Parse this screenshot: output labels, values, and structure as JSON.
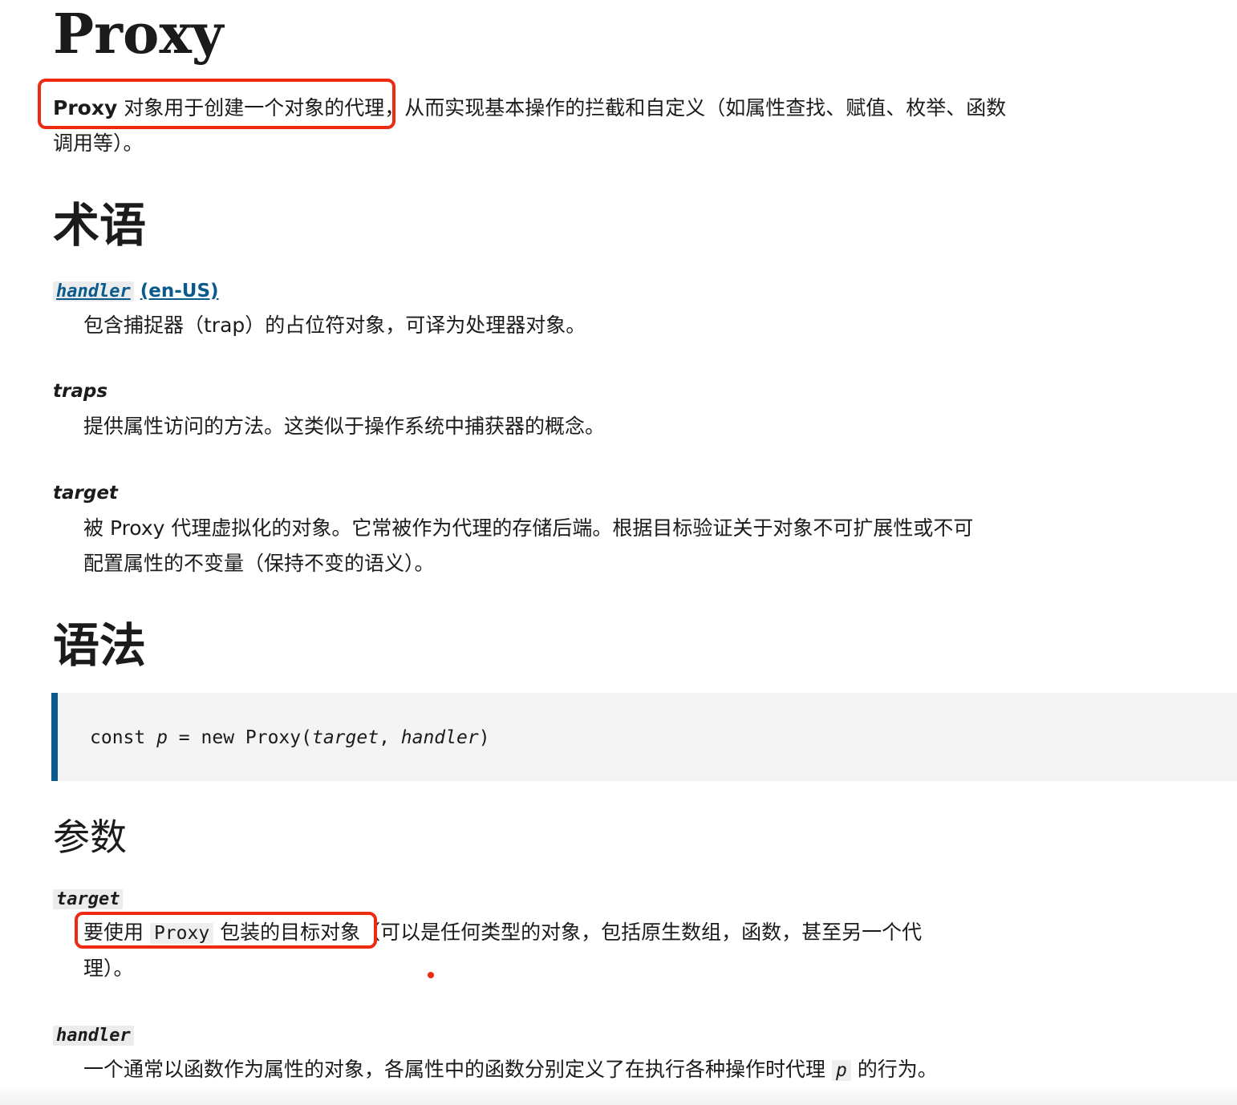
{
  "title": "Proxy",
  "intro": {
    "bold": "Proxy",
    "text": " 对象用于创建一个对象的代理，从而实现基本操作的拦截和自定义（如属性查找、赋值、枚举、函数调用等）。"
  },
  "terminology": {
    "heading": "术语",
    "items": [
      {
        "term": "handler",
        "link": "(en-US)",
        "definition": "包含捕捉器（trap）的占位符对象，可译为处理器对象。"
      },
      {
        "term": "traps",
        "definition": "提供属性访问的方法。这类似于操作系统中捕获器的概念。"
      },
      {
        "term": "target",
        "definition": "被 Proxy 代理虚拟化的对象。它常被作为代理的存储后端。根据目标验证关于对象不可扩展性或不可配置属性的不变量（保持不变的语义）。"
      }
    ]
  },
  "syntax": {
    "heading": "语法",
    "code": {
      "keyword": "const ",
      "var": "p",
      "eq": " = new Proxy(",
      "arg1": "target",
      "comma": ", ",
      "arg2": "handler",
      "close": ")"
    }
  },
  "params": {
    "heading": "参数",
    "target": {
      "term": "target",
      "pre": "要使用 ",
      "code": "Proxy",
      "mid": " 包装的目标对象",
      "post": "（可以是任何类型的对象，包括原生数组，函数，甚至另一个代理）。"
    },
    "handler": {
      "term": "handler",
      "pre": "一个通常以函数作为属性的对象，各属性中的函数分别定义了在执行各种操作时代理 ",
      "code": "p",
      "post": " 的行为。"
    }
  },
  "colors": {
    "annotation": "#ee2a10",
    "link": "#0b5a8c",
    "code_border": "#0b5a8c",
    "code_bg": "#f4f4f4"
  }
}
